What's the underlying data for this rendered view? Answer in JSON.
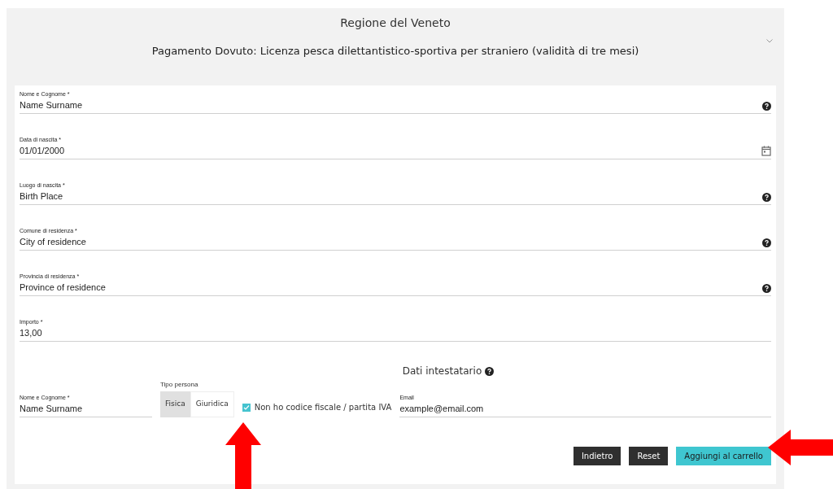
{
  "header": {
    "region": "Regione del Veneto",
    "title": "Pagamento Dovuto: Licenza pesca dilettantistico-sportiva per straniero (validità di tre mesi)"
  },
  "fields": [
    {
      "label": "Nome e Cognome *",
      "value": "Name Surname",
      "kind": "help"
    },
    {
      "label": "Data di nascita *",
      "value": "01/01/2000",
      "kind": "calendar"
    },
    {
      "label": "Luogo di nascita *",
      "value": "Birth Place",
      "kind": "help"
    },
    {
      "label": "Comune di residenza *",
      "value": "City of residence",
      "kind": "help"
    },
    {
      "label": "Provincia di residenza *",
      "value": "Province of residence",
      "kind": "help"
    },
    {
      "label": "Importo *",
      "value": "13,00",
      "kind": "plain"
    }
  ],
  "holder": {
    "heading": "Dati intestatario",
    "name_field": {
      "label": "Nome e Cognome *",
      "value": "Name Surname"
    },
    "person_type": {
      "label": "Tipo persona",
      "options": [
        {
          "label": "Fisica",
          "selected": true
        },
        {
          "label": "Giuridica",
          "selected": false
        }
      ]
    },
    "no_tax_code": {
      "label": "Non ho codice fiscale / partita IVA",
      "checked": true
    },
    "email_field": {
      "label": "Email",
      "value": "example@email.com"
    }
  },
  "buttons": [
    {
      "label": "Indietro",
      "kind": "dark"
    },
    {
      "label": "Reset",
      "kind": "dark"
    },
    {
      "label": "Aggiungi al carrello",
      "kind": "primary"
    }
  ]
}
